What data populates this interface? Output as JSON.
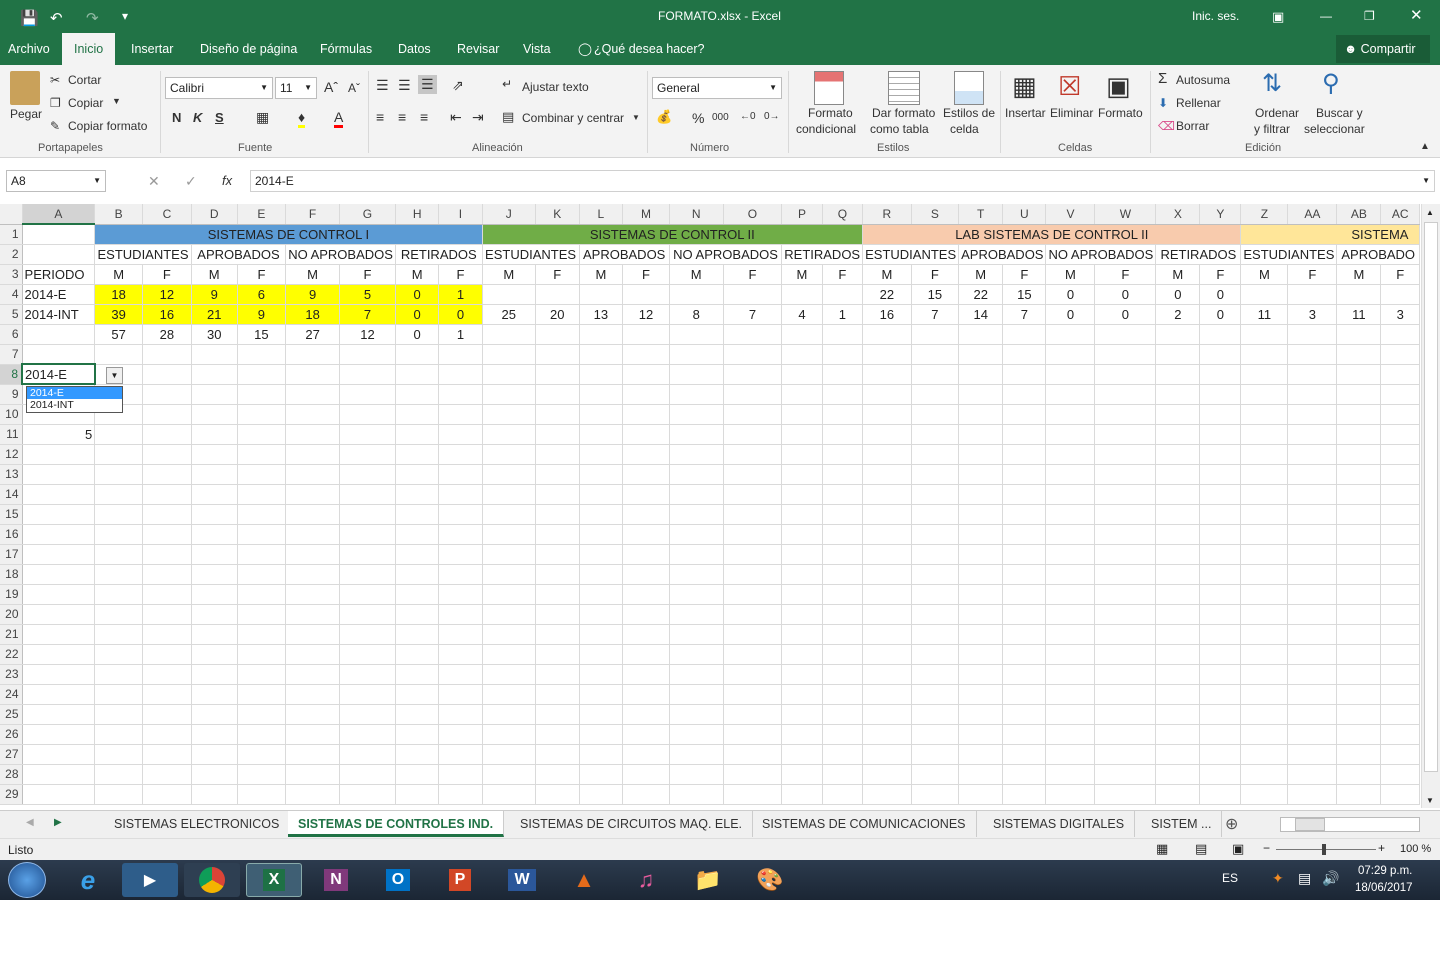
{
  "window": {
    "title": "FORMATO.xlsx  -  Excel",
    "signin": "Inic. ses."
  },
  "menu": {
    "items": [
      "Archivo",
      "Inicio",
      "Insertar",
      "Diseño de página",
      "Fórmulas",
      "Datos",
      "Revisar",
      "Vista"
    ],
    "tell": "¿Qué desea hacer?",
    "share": "Compartir"
  },
  "ribbon": {
    "clipboard": {
      "paste": "Pegar",
      "cut": "Cortar",
      "copy": "Copiar",
      "format_painter": "Copiar formato",
      "group": "Portapapeles"
    },
    "font": {
      "name": "Calibri",
      "size": "11",
      "bold": "N",
      "italic": "K",
      "underline": "S",
      "group": "Fuente"
    },
    "alignment": {
      "wrap": "Ajustar texto",
      "merge": "Combinar y centrar",
      "group": "Alineación"
    },
    "number": {
      "format": "General",
      "percent": "%",
      "thousands": "000",
      "group": "Número"
    },
    "styles": {
      "cond1": "Formato",
      "cond2": "condicional",
      "table1": "Dar formato",
      "table2": "como tabla",
      "cell1": "Estilos de",
      "cell2": "celda",
      "group": "Estilos"
    },
    "cells": {
      "insert": "Insertar",
      "delete": "Eliminar",
      "format": "Formato",
      "group": "Celdas"
    },
    "editing": {
      "autosum": "Autosuma",
      "fill": "Rellenar",
      "clear": "Borrar",
      "sort1": "Ordenar",
      "sort2": "y filtrar",
      "find1": "Buscar y",
      "find2": "seleccionar",
      "group": "Edición"
    }
  },
  "formula_bar": {
    "name_box": "A8",
    "fx": "fx",
    "value": "2014-E"
  },
  "columns": [
    "A",
    "B",
    "C",
    "D",
    "E",
    "F",
    "G",
    "H",
    "I",
    "J",
    "K",
    "L",
    "M",
    "N",
    "O",
    "P",
    "Q",
    "R",
    "S",
    "T",
    "U",
    "V",
    "W",
    "X",
    "Y",
    "Z",
    "AA",
    "AB",
    "AC"
  ],
  "sheet": {
    "r1": {
      "g1": "SISTEMAS DE CONTROL I",
      "g2": "SISTEMAS DE CONTROL II",
      "g3": "LAB SISTEMAS DE CONTROL II",
      "g4": "SISTEMA"
    },
    "r2": [
      "ESTUDIANTES",
      "APROBADOS",
      "NO APROBADOS",
      "RETIRADOS",
      "ESTUDIANTES",
      "APROBADOS",
      "NO APROBADOS",
      "RETIRADOS",
      "ESTUDIANTES",
      "APROBADOS",
      "NO APROBADOS",
      "RETIRADOS",
      "ESTUDIANTES",
      "APROBADO"
    ],
    "r3": [
      "PERIODO",
      "M",
      "F",
      "M",
      "F",
      "M",
      "F",
      "M",
      "F",
      "M",
      "F",
      "M",
      "F",
      "M",
      "F",
      "M",
      "F",
      "M",
      "F",
      "M",
      "F",
      "M",
      "F",
      "M",
      "F",
      "M",
      "F",
      "M",
      "F"
    ],
    "r4": [
      "2014-E",
      "18",
      "12",
      "9",
      "6",
      "9",
      "5",
      "0",
      "1",
      "",
      "",
      "",
      "",
      "",
      "",
      "",
      "",
      "22",
      "15",
      "22",
      "15",
      "0",
      "0",
      "0",
      "0",
      "",
      "",
      "",
      ""
    ],
    "r5": [
      "2014-INT",
      "39",
      "16",
      "21",
      "9",
      "18",
      "7",
      "0",
      "0",
      "25",
      "20",
      "13",
      "12",
      "8",
      "7",
      "4",
      "1",
      "16",
      "7",
      "14",
      "7",
      "0",
      "0",
      "2",
      "0",
      "11",
      "3",
      "11",
      "3"
    ],
    "r6": [
      "",
      "57",
      "28",
      "30",
      "15",
      "27",
      "12",
      "0",
      "1",
      "",
      "",
      "",
      "",
      "",
      "",
      "",
      "",
      "",
      "",
      "",
      "",
      "",
      "",
      "",
      "",
      "",
      "",
      "",
      ""
    ],
    "a8": "2014-E",
    "a11": "5"
  },
  "dropdown": {
    "options": [
      "2014-E",
      "2014-INT"
    ]
  },
  "tabs": [
    "SISTEMAS ELECTRONICOS",
    "SISTEMAS DE CONTROLES IND.",
    "SISTEMAS DE CIRCUITOS MAQ. ELE.",
    "SISTEMAS DE COMUNICACIONES",
    "SISTEMAS DIGITALES",
    "SISTEM ..."
  ],
  "status": {
    "ready": "Listo",
    "zoom": "100 %"
  },
  "taskbar": {
    "lang": "ES",
    "time": "07:29 p.m.",
    "date": "18/06/2017"
  },
  "colors": {
    "excel_green": "#217346",
    "blue_header": "#5b9bd5",
    "green_header": "#70ad47",
    "orange_header": "#f8cbad",
    "gold_header": "#ffe699",
    "highlight": "#ffff00"
  }
}
